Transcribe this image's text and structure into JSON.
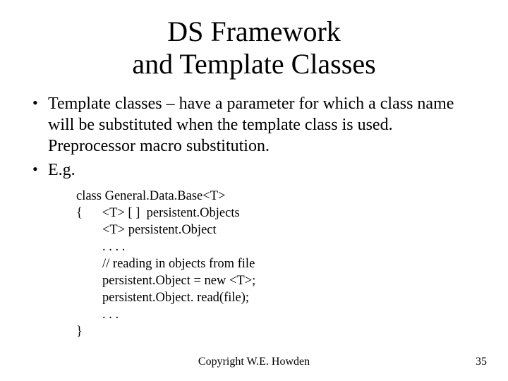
{
  "title_line1": "DS Framework",
  "title_line2": "and Template Classes",
  "bullets": [
    "Template classes – have a parameter for which a class name will be substituted when the template class is used.  Preprocessor macro substitution.",
    "E.g."
  ],
  "code": "class General.Data.Base<T>\n{      <T> [ ]  persistent.Objects\n        <T> persistent.Object\n        . . . .\n        // reading in objects from file\n        persistent.Object = new <T>;\n        persistent.Object. read(file);\n        . . .\n}",
  "footer_center": "Copyright W.E. Howden",
  "footer_right": "35"
}
